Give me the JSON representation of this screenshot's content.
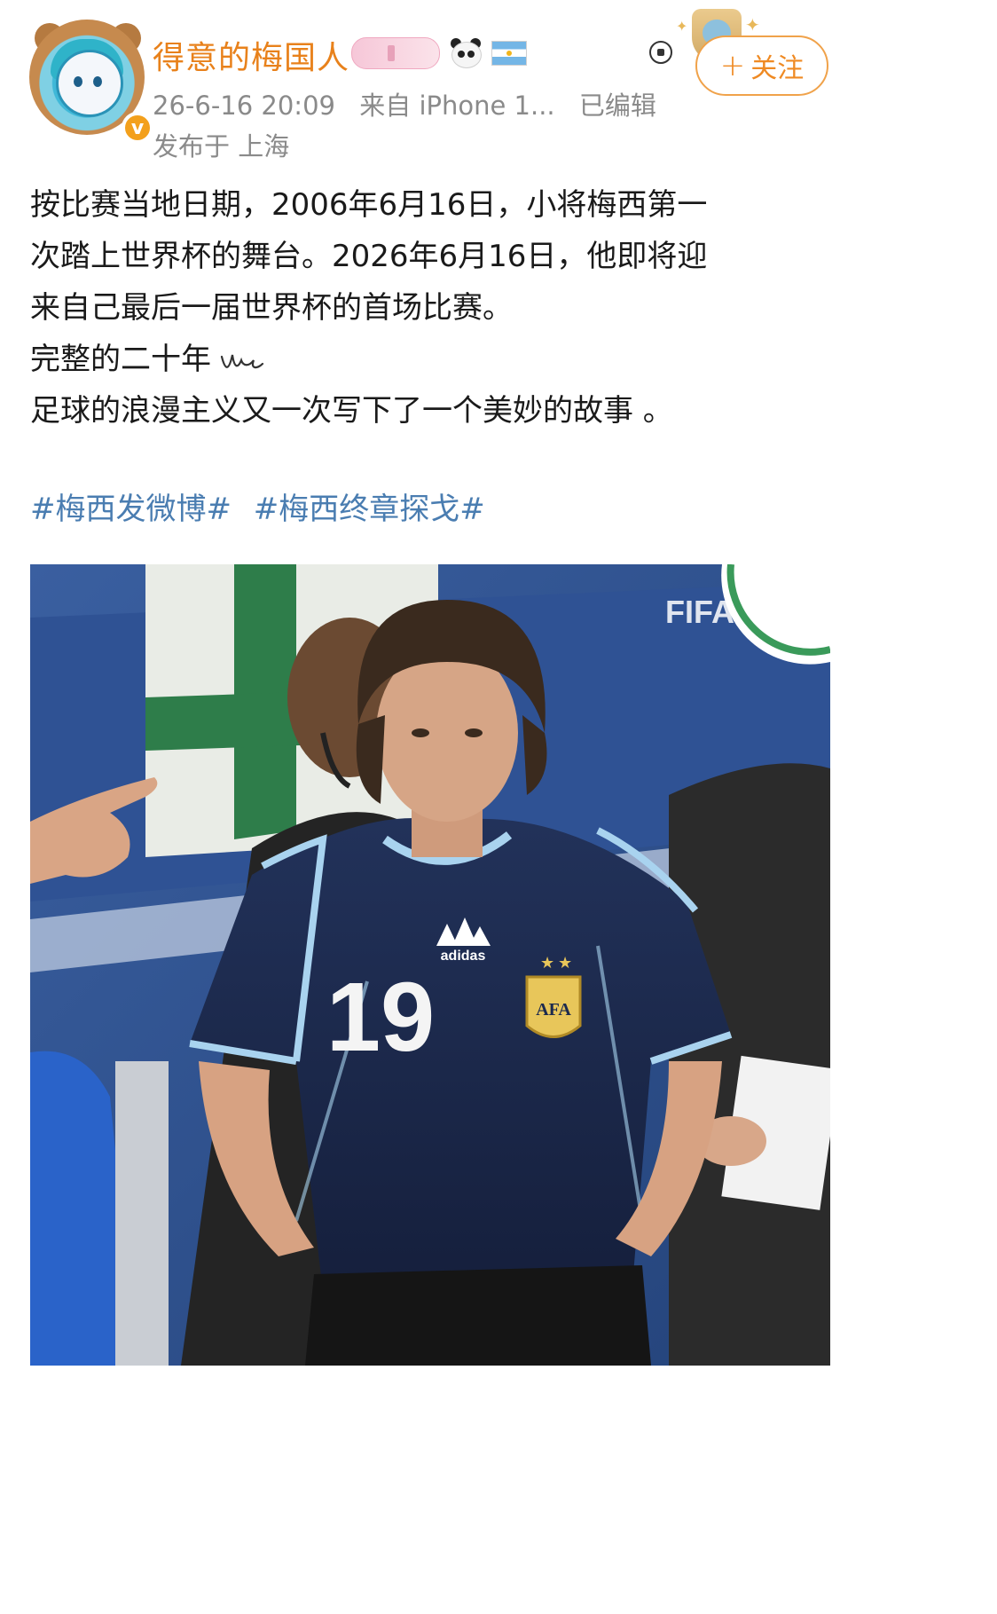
{
  "user": {
    "name": "得意的梅国人",
    "verified": true
  },
  "meta": {
    "time": "26-6-16 20:09",
    "source_prefix": "来自",
    "device": "iPhone 1...",
    "edited": "已编辑",
    "location": "发布于 上海"
  },
  "follow_label": "关注",
  "post": {
    "line1": "按比赛当地日期，2006年6月16日，小将梅西第一",
    "line2": "次踏上世界杯的舞台。2026年6月16日，他即将迎",
    "line3": "来自己最后一届世界杯的首场比赛。",
    "line4": "完整的二十年",
    "line5": "足球的浪漫主义又一次写下了一个美妙的故事 。"
  },
  "hashtags": [
    "#梅西发微博#",
    "#梅西终章探戈#"
  ],
  "photo": {
    "fifa_watermark": "FIFA",
    "jersey_number": "19",
    "crest_text": "AFA",
    "brand_text": "adidas"
  },
  "colors": {
    "username": "#e8811b",
    "meta_gray": "#8a8a8a",
    "hashtag": "#4a7db1",
    "follow_orange": "#ef8a23",
    "jersey_navy": "#1c2a4e",
    "jersey_trim": "#a9d3ef"
  }
}
